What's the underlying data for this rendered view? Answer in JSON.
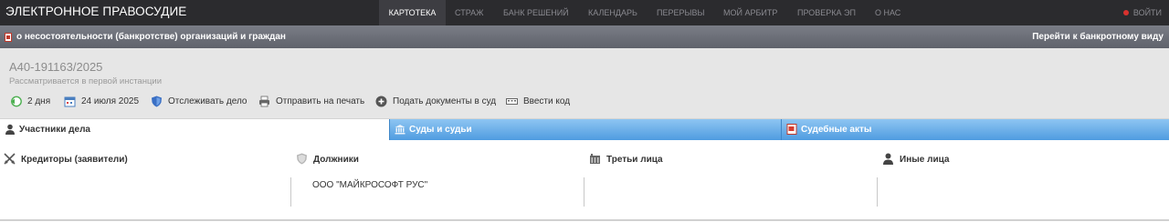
{
  "header": {
    "brand": "ЭЛЕКТРОННОЕ ПРАВОСУДИЕ",
    "nav": [
      {
        "label": "КАРТОТЕКА"
      },
      {
        "label": "СТРАЖ"
      },
      {
        "label": "БАНК РЕШЕНИЙ"
      },
      {
        "label": "КАЛЕНДАРЬ"
      },
      {
        "label": "ПЕРЕРЫВЫ"
      },
      {
        "label": "МОЙ АРБИТР"
      },
      {
        "label": "ПРОВЕРКА ЭП"
      },
      {
        "label": "О НАС"
      }
    ],
    "login": "ВОЙТИ"
  },
  "category_bar": {
    "title": "о несостоятельности (банкротстве) организаций и граждан",
    "link": "Перейти к банкротному виду"
  },
  "case": {
    "number": "А40-191163/2025",
    "status": "Рассматривается в первой инстанции",
    "toolbar": {
      "duration": "2 дня",
      "date": "24 июля 2025",
      "track": "Отслеживать дело",
      "print": "Отправить на печать",
      "submit": "Подать документы в суд",
      "code": "Ввести код"
    }
  },
  "tabs": [
    {
      "label": "Участники дела"
    },
    {
      "label": "Суды и судьи"
    },
    {
      "label": "Судебные акты"
    }
  ],
  "participants": {
    "creditors": {
      "title": "Кредиторы (заявители)"
    },
    "debtors": {
      "title": "Должники",
      "items": [
        "ООО \"МАЙКРОСОФТ РУС\""
      ]
    },
    "third_parties": {
      "title": "Третьи лица"
    },
    "others": {
      "title": "Иные лица"
    }
  },
  "colors": {
    "nav_bg": "#2b2b2e",
    "tab_blue": "#5aa5e4",
    "login_dot": "#d9322e",
    "case_bg": "#e6e6e6"
  }
}
